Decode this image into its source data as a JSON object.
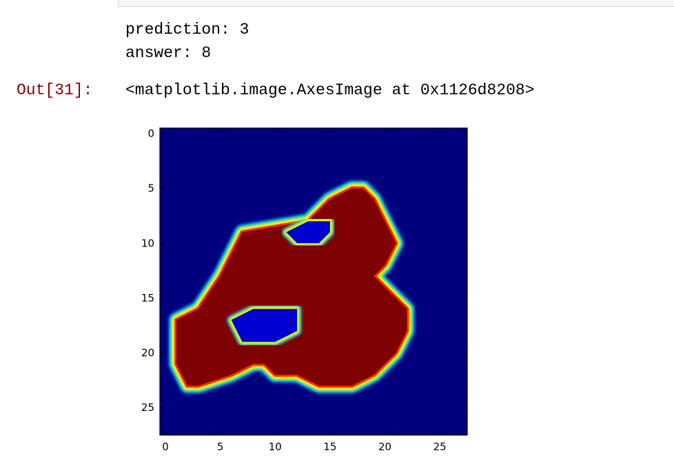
{
  "stdout": {
    "prediction_line": "prediction: 3",
    "answer_line": "answer: 8"
  },
  "output": {
    "prompt": "Out[31]:",
    "repr": "<matplotlib.image.AxesImage at 0x1126d8208>"
  },
  "chart_data": {
    "type": "heatmap",
    "colormap": "jet",
    "xlim": [
      -0.5,
      27.5
    ],
    "ylim": [
      27.5,
      -0.5
    ],
    "x_ticks": [
      0,
      5,
      10,
      15,
      20,
      25
    ],
    "y_ticks": [
      0,
      5,
      10,
      15,
      20,
      25
    ],
    "grid": false,
    "interpolation": "smooth",
    "image_size": [
      28,
      28
    ],
    "digit_outline": [
      [
        8,
        13
      ],
      [
        6,
        15
      ],
      [
        5,
        17
      ],
      [
        5,
        18
      ],
      [
        6,
        19
      ],
      [
        8,
        20
      ],
      [
        10,
        21
      ],
      [
        12,
        20
      ],
      [
        13,
        19
      ],
      [
        14,
        20
      ],
      [
        16,
        22
      ],
      [
        18,
        22
      ],
      [
        20,
        21
      ],
      [
        22,
        19
      ],
      [
        23,
        17
      ],
      [
        23,
        14
      ],
      [
        22,
        12
      ],
      [
        22,
        10
      ],
      [
        21,
        9
      ],
      [
        21,
        8
      ],
      [
        22,
        6
      ],
      [
        23,
        3
      ],
      [
        23,
        2
      ],
      [
        21,
        1
      ],
      [
        19,
        1
      ],
      [
        17,
        1
      ],
      [
        16,
        3
      ],
      [
        13,
        5
      ],
      [
        11,
        6
      ],
      [
        9,
        7
      ]
    ],
    "upper_hole": [
      [
        9,
        11
      ],
      [
        8,
        13
      ],
      [
        8,
        15
      ],
      [
        9,
        15
      ],
      [
        10,
        14
      ],
      [
        10,
        12
      ]
    ],
    "lower_hole": [
      [
        17,
        6
      ],
      [
        16,
        8
      ],
      [
        16,
        12
      ],
      [
        18,
        12
      ],
      [
        19,
        10
      ],
      [
        19,
        7
      ]
    ],
    "colors": {
      "background": "#00007f",
      "stroke": "#7f0000"
    }
  }
}
